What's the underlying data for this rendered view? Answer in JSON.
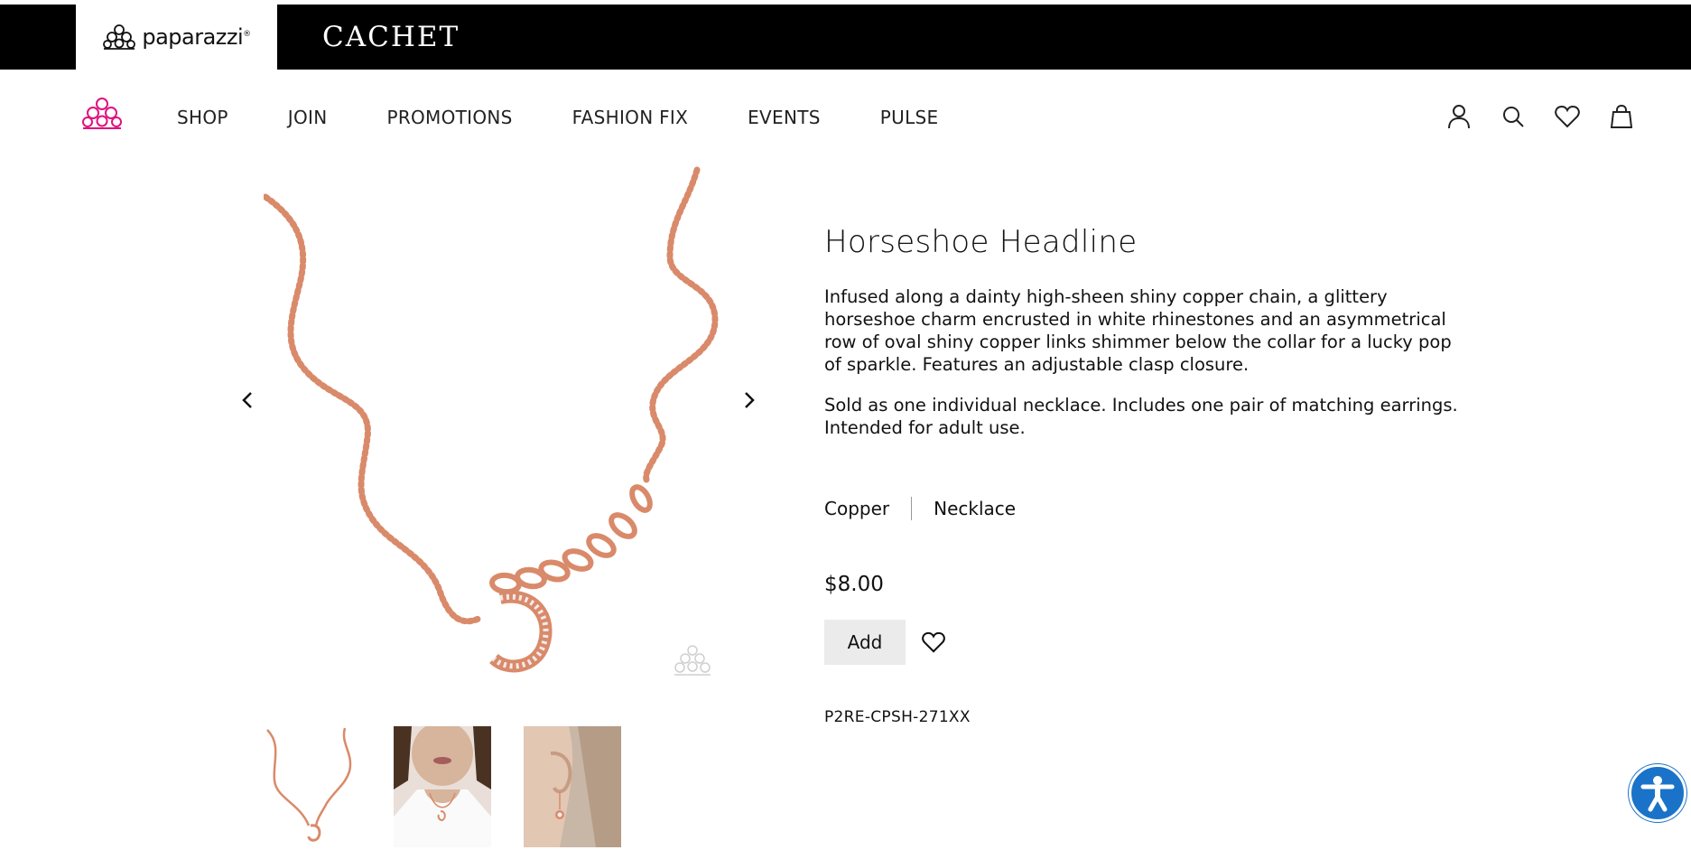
{
  "brand": {
    "name": "paparazzi",
    "reg": "®",
    "secondary": "CACHET"
  },
  "nav": {
    "links": [
      "SHOP",
      "JOIN",
      "PROMOTIONS",
      "FASHION FIX",
      "EVENTS",
      "PULSE"
    ],
    "icons": [
      "account-icon",
      "search-icon",
      "heart-icon",
      "bag-icon"
    ]
  },
  "product": {
    "title": "Horseshoe Headline",
    "description": "Infused along a dainty high-sheen shiny copper chain, a glittery horseshoe charm encrusted in white rhinestones and an asymmetrical row of oval shiny copper links shimmer below the collar for a lucky pop of sparkle. Features an adjustable clasp closure.",
    "details": "Sold as one individual necklace. Includes one pair of matching earrings. Intended for adult use.",
    "color": "Copper",
    "category": "Necklace",
    "price": "$8.00",
    "add_label": "Add",
    "sku": "P2RE-CPSH-271XX"
  },
  "colors": {
    "brand_pink": "#e0117f",
    "copper": "#d98a6a",
    "accessibility_blue": "#1a73c8",
    "button_bg": "#ebebeb"
  }
}
